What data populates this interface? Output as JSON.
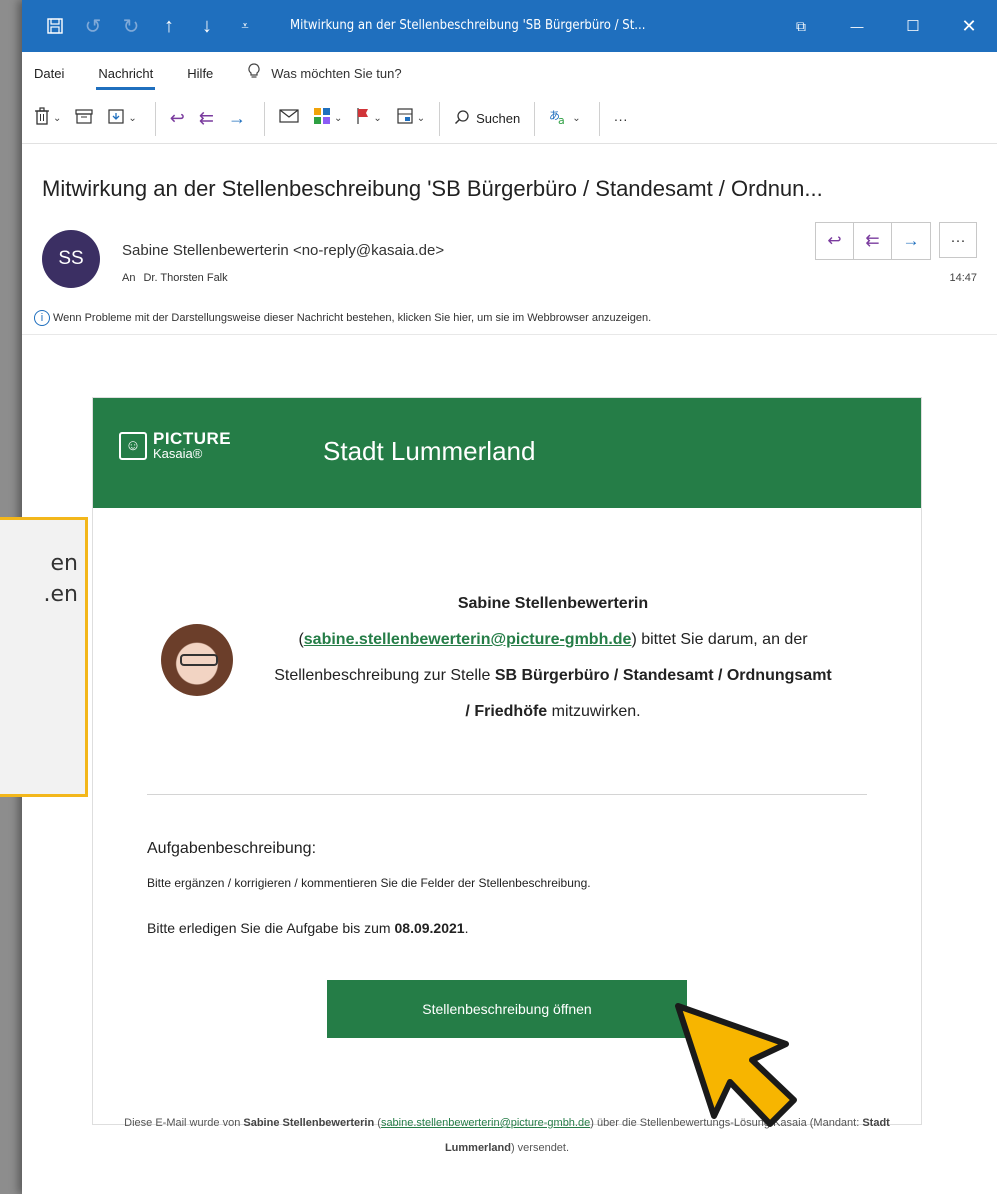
{
  "window": {
    "title": "Mitwirkung an der Stellenbeschreibung 'SB Bürgerbüro / St...",
    "controls": {
      "ribbon_display": "⧉",
      "minimize": "—",
      "maximize": "☐",
      "close": "✕"
    }
  },
  "quick_access": [
    "save-icon",
    "undo-icon",
    "redo-icon",
    "up-arrow-icon",
    "down-arrow-icon",
    "customize-icon"
  ],
  "menu": {
    "items": [
      "Datei",
      "Nachricht",
      "Hilfe"
    ],
    "active": "Nachricht",
    "tell_me": "Was möchten Sie tun?"
  },
  "ribbon": {
    "search_label": "Suchen",
    "more_label": "···"
  },
  "email": {
    "subject": "Mitwirkung an der Stellenbeschreibung 'SB Bürgerbüro / Standesamt / Ordnun...",
    "avatar_initials": "SS",
    "sender": "Sabine Stellenbewerterin <no-reply@kasaia.de>",
    "to_label": "An",
    "recipient": "Dr. Thorsten Falk",
    "time": "14:47",
    "info_text": "Wenn Probleme mit der Darstellungsweise dieser Nachricht bestehen, klicken Sie hier, um sie im Webbrowser anzuzeigen.",
    "action_more": "···"
  },
  "body": {
    "logo_big": "PICTURE",
    "logo_small": "Kasaia®",
    "org_name": "Stadt Lummerland",
    "invite_name": "Sabine Stellenbewerterin",
    "invite_email": "sabine.stellenbewerterin@picture-gmbh.de",
    "invite_text_1": " bittet Sie darum, an der Stellenbeschreibung zur Stelle ",
    "invite_job": "SB Bürgerbüro / Standesamt / Ordnungsamt / Friedhöfe",
    "invite_text_2": " mitzuwirken.",
    "task_heading": "Aufgabenbeschreibung:",
    "task_line": "Bitte ergänzen / korrigieren / kommentieren Sie die Felder der Stellenbeschreibung.",
    "deadline_prefix": "Bitte erledigen Sie die Aufgabe bis zum ",
    "deadline_date": "08.09.2021",
    "deadline_suffix": ".",
    "open_button": "Stellenbeschreibung öffnen",
    "footer_1": "Diese E-Mail wurde von ",
    "footer_name": "Sabine Stellenbewerterin",
    "footer_email": "sabine.stellenbewerterin@picture-gmbh.de",
    "footer_2": " über die Stellenbewertungs-Lösung Kasaia (Mandant: ",
    "footer_org": "Stadt Lummerland",
    "footer_3": ") versendet."
  },
  "callout": {
    "line_1": "en",
    "line_2": "en."
  },
  "colors": {
    "titlebar": "#1f6fbe",
    "brand_green": "#257d47",
    "callout_border": "#f3b71b",
    "cursor_fill": "#f7b500"
  }
}
